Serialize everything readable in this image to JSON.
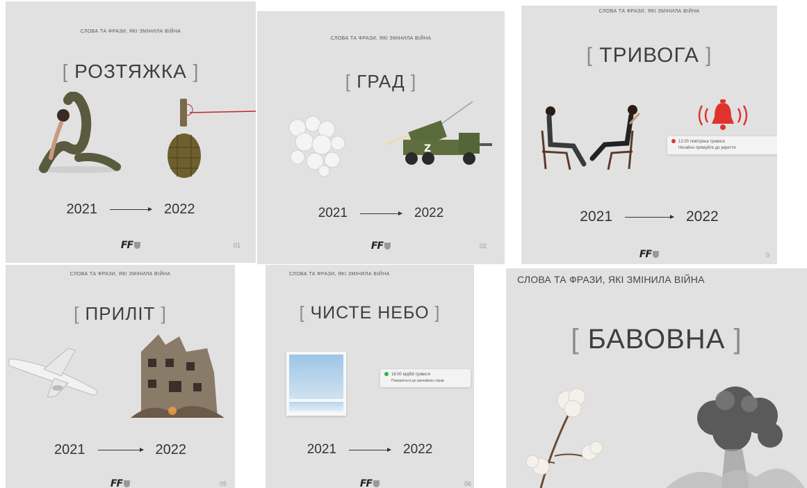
{
  "subtitle": "СЛОВА ТА ФРАЗИ, ЯКІ ЗМІНИЛА ВІЙНА",
  "year_from": "2021",
  "year_to": "2022",
  "logo_text": "FF",
  "bracket_open": "[",
  "bracket_close": "]",
  "cards": [
    {
      "word": "РОЗТЯЖКА",
      "page": "01"
    },
    {
      "word": "ГРАД",
      "page": "02"
    },
    {
      "word": "ТРИВОГА",
      "page": "0"
    },
    {
      "word": "ПРИЛІТ",
      "page": "05"
    },
    {
      "word": "ЧИСТЕ НЕБО",
      "page": "06"
    },
    {
      "word": "БАВОВНА"
    }
  ],
  "alarm_notification": {
    "time": "12:00",
    "title": "повітряна тривога",
    "text": "Негайно прямуйте до укриття"
  },
  "clear_notification": {
    "time": "16:00",
    "title": "відбій тривоги",
    "text": "Поверніться до звичайних справ"
  },
  "colors": {
    "card_bg": "#e1e1e1",
    "alarm_red": "#e0332f",
    "clear_green": "#2fb34a",
    "text_dark": "#3a3a3a"
  }
}
